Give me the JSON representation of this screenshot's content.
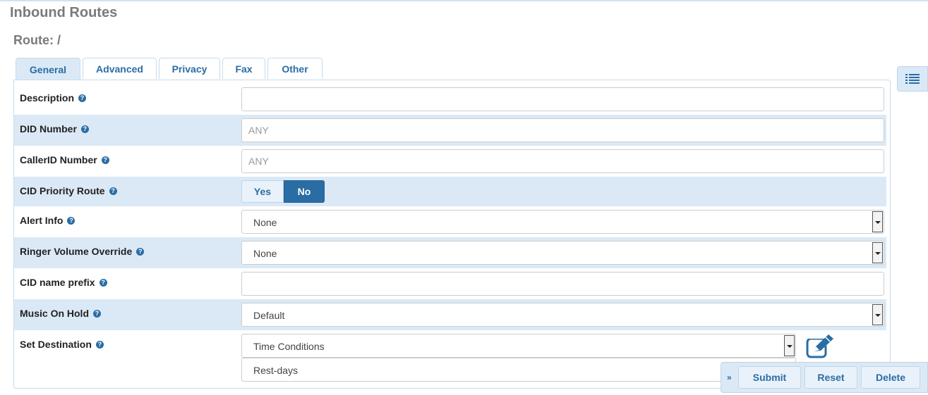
{
  "page": {
    "title": "Inbound Routes",
    "route_title": "Route: /"
  },
  "tabs": [
    "General",
    "Advanced",
    "Privacy",
    "Fax",
    "Other"
  ],
  "help_glyph": "?",
  "fields": {
    "description": {
      "label": "Description",
      "value": ""
    },
    "did_number": {
      "label": "DID Number",
      "placeholder": "ANY"
    },
    "callerid_number": {
      "label": "CallerID Number",
      "placeholder": "ANY"
    },
    "cid_priority": {
      "label": "CID Priority Route",
      "yes": "Yes",
      "no": "No",
      "selected": "No"
    },
    "alert_info": {
      "label": "Alert Info",
      "value": "None"
    },
    "ringer_volume": {
      "label": "Ringer Volume Override",
      "value": "None"
    },
    "cid_prefix": {
      "label": "CID name prefix",
      "value": ""
    },
    "music_on_hold": {
      "label": "Music On Hold",
      "value": "Default"
    },
    "set_destination": {
      "label": "Set Destination",
      "value": "Time Conditions",
      "sub_value": "Rest-days"
    }
  },
  "actions": {
    "collapse": "»",
    "submit": "Submit",
    "reset": "Reset",
    "delete": "Delete"
  },
  "colors": {
    "accent": "#2a6da5",
    "row_shade": "#dbe9f6",
    "title_gray": "#7a7a7a"
  },
  "icons": {
    "side_panel": "list-icon",
    "edit": "edit-icon",
    "help": "help-icon"
  }
}
